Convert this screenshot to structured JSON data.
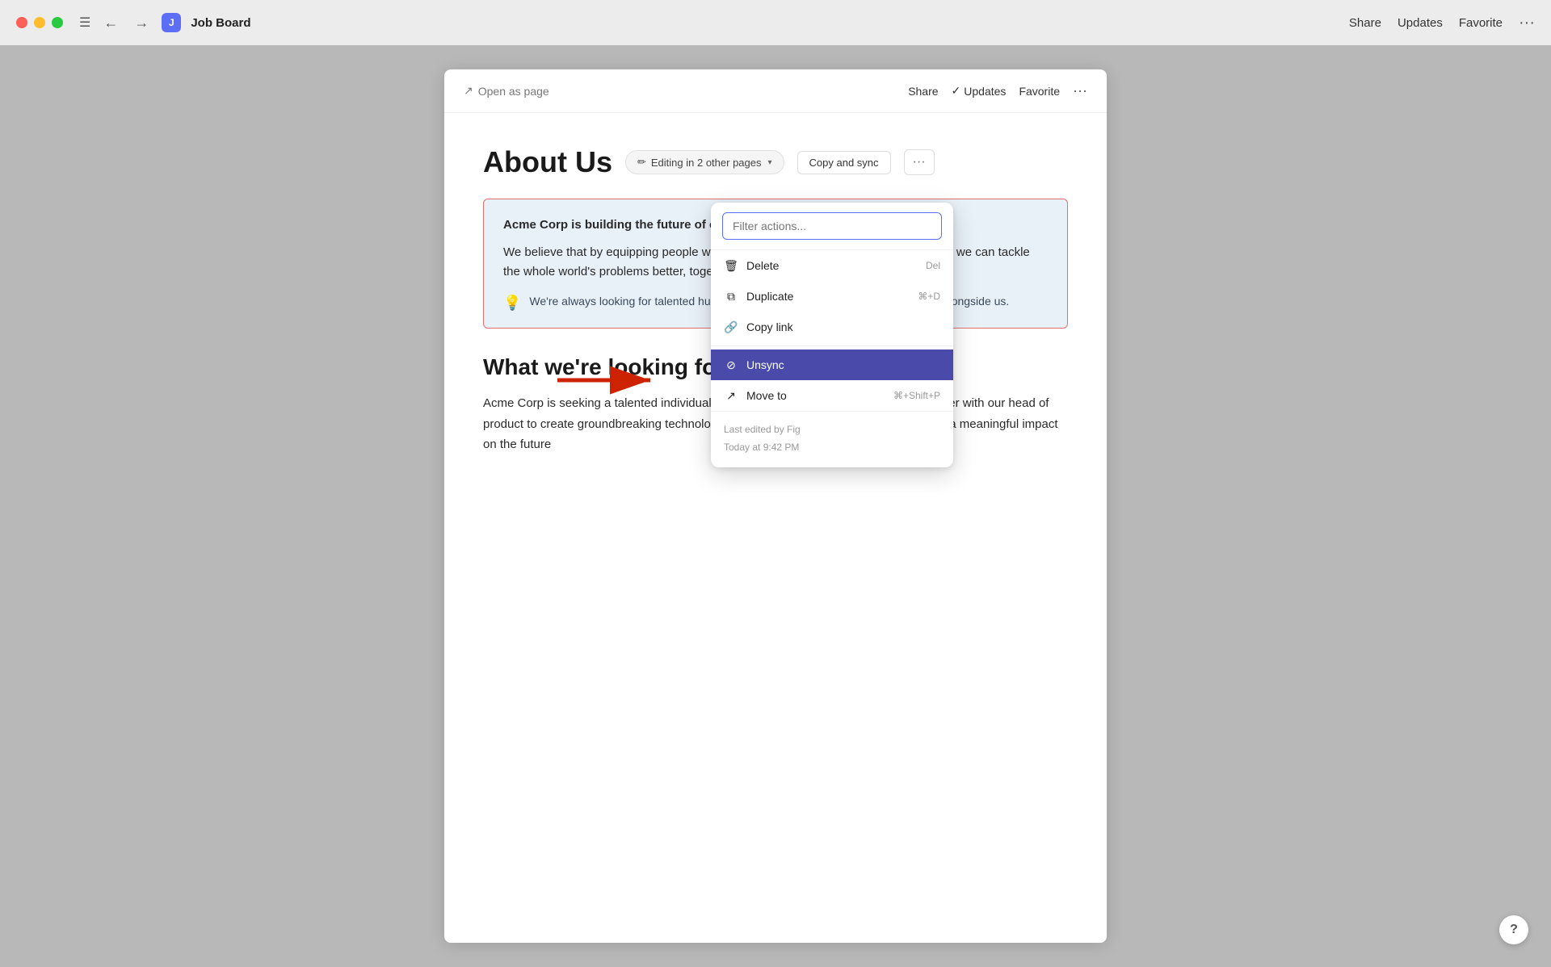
{
  "titlebar": {
    "app_title": "Job Board",
    "share_label": "Share",
    "updates_label": "Updates",
    "favorite_label": "Favorite"
  },
  "doc": {
    "open_as_page": "Open as page",
    "share_label": "Share",
    "updates_label": "Updates",
    "favorite_label": "Favorite",
    "title": "About Us",
    "editing_badge": "Editing in  2 other pages",
    "copy_sync_label": "Copy and sync",
    "synced_body_bold": "Acme Corp is building the future of computing.",
    "synced_body_text": "We believe that by equipping people with the best tools to solve their own problems, we can tackle the whole world's problems better, together.",
    "synced_hint": "We're always looking for talented humans who are interested in building the future alongside us.",
    "section2_title": "What we're looking for",
    "section2_text": "Acme Corp is seeking a talented individual who possesses infinite curiosity.\nYou'll partner with our head of product to create groundbreaking technology.\nThis is an incredible opportunity to make a meaningful impact on the future"
  },
  "context_menu": {
    "filter_placeholder": "Filter actions...",
    "items": [
      {
        "id": "delete",
        "label": "Delete",
        "icon": "🗑",
        "shortcut": "Del"
      },
      {
        "id": "duplicate",
        "label": "Duplicate",
        "icon": "⧉",
        "shortcut": "⌘+D"
      },
      {
        "id": "copy-link",
        "label": "Copy link",
        "icon": "🔗",
        "shortcut": ""
      },
      {
        "id": "unsync",
        "label": "Unsync",
        "icon": "⊘",
        "shortcut": "",
        "active": true
      },
      {
        "id": "move-to",
        "label": "Move to",
        "icon": "↗",
        "shortcut": "⌘+Shift+P"
      }
    ],
    "footer": {
      "edited_by": "Last edited by Fig",
      "edited_time": "Today at 9:42 PM"
    }
  }
}
